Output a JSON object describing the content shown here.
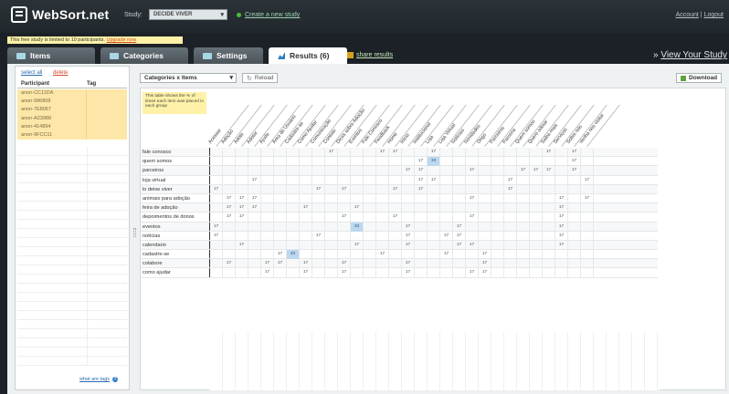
{
  "header": {
    "logo_text": "WebSort.net",
    "study_label": "Study:",
    "study_value": "DECIDE VIVER",
    "create_link": "Create a new study",
    "account": "Account",
    "logout": "Logout"
  },
  "limit_notice": {
    "text": "This free study is limited to 10 participants. ",
    "upgrade": "Upgrade now"
  },
  "tabs": [
    {
      "label": "Items"
    },
    {
      "label": "Categories"
    },
    {
      "label": "Settings"
    },
    {
      "label": "Results (6)"
    }
  ],
  "share_results": "share results",
  "view_study": "View Your Study",
  "sidebar": {
    "select_all": "select all",
    "delete": "delete",
    "col_participant": "Participant",
    "col_tag": "Tag",
    "participants": [
      "anon-CC11DA",
      "anon-586808",
      "anon-7E8067",
      "anon-A23988",
      "anon-414894",
      "anon-9FCC11"
    ],
    "footer_link": "what are tags"
  },
  "toolbar": {
    "view_select": "Categories x Items",
    "reload": "Reload",
    "download": "Download"
  },
  "matrix": {
    "explain": "This table shows the % of times each item was placed in each group",
    "columns": [
      "Acessar",
      "Adoção",
      "Adote",
      "Adotar",
      "Ajuda",
      "Área do Usuário",
      "Cadastre-se",
      "Como Ajudar",
      "Comunicação",
      "Contato",
      "Dicas sobre Adoção",
      "Eventos",
      "Fale Conosco",
      "Feedback",
      "Home",
      "Início",
      "Institucional",
      "Loja",
      "Loja Virtual",
      "Notícias",
      "Novidades",
      "Ongs",
      "Parceiros",
      "Parceria",
      "Quem somos",
      "Quero adotar",
      "Saiba mais",
      "Serviços",
      "Sobre nós",
      "Venha nos visitar"
    ],
    "rows": [
      {
        "label": "fale conosco",
        "cells": [
          "",
          "",
          "",
          "",
          "",
          "",
          "",
          "",
          "",
          "17",
          "",
          "",
          "",
          "17",
          "17",
          "",
          "",
          "17",
          "",
          "",
          "",
          "",
          "",
          "",
          "",
          "",
          "17",
          "",
          "17",
          ""
        ]
      },
      {
        "label": "quem somos",
        "cells": [
          "",
          "",
          "",
          "",
          "",
          "",
          "",
          "",
          "",
          "",
          "",
          "",
          "",
          "",
          "",
          "",
          "17",
          "33",
          "",
          "",
          "",
          "",
          "",
          "",
          "",
          "",
          "",
          "",
          "17",
          ""
        ]
      },
      {
        "label": "parceiros",
        "cells": [
          "",
          "",
          "",
          "",
          "",
          "",
          "",
          "",
          "",
          "",
          "",
          "",
          "",
          "",
          "",
          "17",
          "17",
          "",
          "",
          "",
          "17",
          "",
          "",
          "",
          "17",
          "17",
          "17",
          "",
          "17",
          ""
        ]
      },
      {
        "label": "loja virtual",
        "cells": [
          "",
          "",
          "",
          "17",
          "",
          "",
          "",
          "",
          "",
          "",
          "",
          "",
          "",
          "",
          "",
          "",
          "17",
          "17",
          "",
          "",
          "",
          "",
          "",
          "17",
          "",
          "",
          "",
          "",
          "",
          "17"
        ]
      },
      {
        "label": "lo deixe viver",
        "cells": [
          "17",
          "",
          "",
          "",
          "",
          "",
          "",
          "",
          "17",
          "",
          "17",
          "",
          "",
          "",
          "17",
          "",
          "17",
          "",
          "",
          "",
          "",
          "",
          "",
          "17",
          "",
          "",
          "",
          "",
          "",
          ""
        ]
      },
      {
        "label": "animais para adoção",
        "cells": [
          "",
          "17",
          "17",
          "17",
          "",
          "",
          "",
          "",
          "",
          "",
          "",
          "",
          "",
          "",
          "",
          "",
          "",
          "",
          "",
          "",
          "17",
          "",
          "",
          "",
          "",
          "",
          "",
          "17",
          "",
          "17"
        ]
      },
      {
        "label": "feira de adoção",
        "cells": [
          "",
          "17",
          "17",
          "17",
          "",
          "",
          "",
          "17",
          "",
          "",
          "",
          "17",
          "",
          "",
          "",
          "",
          "",
          "",
          "",
          "",
          "",
          "",
          "",
          "",
          "",
          "",
          "",
          "17",
          "",
          ""
        ]
      },
      {
        "label": "depoimentos de donos",
        "cells": [
          "",
          "17",
          "17",
          "",
          "",
          "",
          "",
          "",
          "",
          "",
          "17",
          "",
          "",
          "",
          "17",
          "",
          "",
          "",
          "",
          "",
          "17",
          "",
          "",
          "",
          "",
          "",
          "",
          "17",
          "",
          ""
        ]
      },
      {
        "label": "eventos",
        "cells": [
          "17",
          "",
          "",
          "",
          "",
          "",
          "",
          "",
          "",
          "",
          "",
          "33",
          "",
          "",
          "",
          "17",
          "",
          "",
          "",
          "17",
          "",
          "",
          "",
          "",
          "",
          "",
          "",
          "17",
          "",
          ""
        ]
      },
      {
        "label": "notícias",
        "cells": [
          "17",
          "",
          "",
          "",
          "",
          "",
          "",
          "",
          "17",
          "",
          "",
          "",
          "",
          "",
          "",
          "17",
          "",
          "",
          "17",
          "17",
          "",
          "",
          "",
          "",
          "",
          "",
          "",
          "17",
          "",
          ""
        ]
      },
      {
        "label": "calendario",
        "cells": [
          "",
          "",
          "17",
          "",
          "",
          "",
          "",
          "",
          "",
          "",
          "",
          "17",
          "",
          "",
          "",
          "17",
          "",
          "",
          "",
          "17",
          "17",
          "",
          "",
          "",
          "",
          "",
          "",
          "17",
          "",
          ""
        ]
      },
      {
        "label": "cadastre-se",
        "cells": [
          "",
          "",
          "",
          "",
          "",
          "17",
          "33",
          "",
          "",
          "",
          "",
          "",
          "",
          "17",
          "",
          "",
          "",
          "",
          "17",
          "",
          "",
          "17",
          "",
          "",
          "",
          "",
          "",
          "",
          "",
          ""
        ]
      },
      {
        "label": "colabore",
        "cells": [
          "",
          "17",
          "",
          "",
          "17",
          "17",
          "",
          "17",
          "",
          "",
          "17",
          "",
          "",
          "",
          "",
          "17",
          "",
          "",
          "",
          "",
          "",
          "17",
          "",
          "",
          "",
          "",
          "",
          "",
          "",
          ""
        ]
      },
      {
        "label": "como ajudar",
        "cells": [
          "",
          "",
          "",
          "",
          "17",
          "",
          "",
          "17",
          "",
          "",
          "17",
          "",
          "",
          "",
          "",
          "17",
          "",
          "",
          "",
          "",
          "17",
          "17",
          "",
          "",
          "",
          "",
          "",
          "",
          "",
          ""
        ]
      }
    ]
  },
  "colors": {
    "highlight": "#bcd8ef",
    "participant_bg": "#fde7a8"
  }
}
